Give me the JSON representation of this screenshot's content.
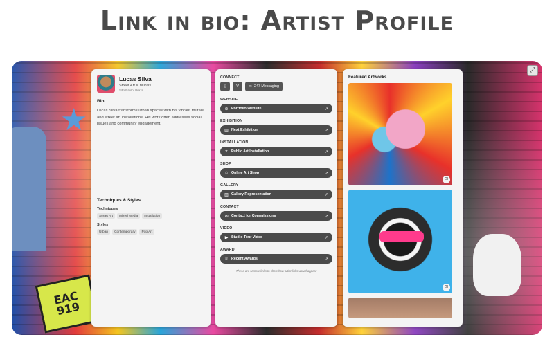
{
  "page": {
    "heading": "Link in bio: Artist Profile"
  },
  "profile": {
    "name": "Lucas Silva",
    "subtitle": "Street Art & Murals",
    "location": "São Paulo, Brazil",
    "bio_title": "Bio",
    "bio_text": "Lucas Silva transforms urban spaces with his vibrant murals and street art installations. His work often addresses social issues and community engagement."
  },
  "techniques": {
    "title": "Techniques & Styles",
    "techniques_label": "Techniques",
    "techniques": [
      "Street Art",
      "Mixed Media",
      "Installation"
    ],
    "styles_label": "Styles",
    "styles": [
      "Urban",
      "Contemporary",
      "Pop Art"
    ]
  },
  "links": {
    "connect_label": "CONNECT",
    "social": [
      {
        "icon": "instagram-icon"
      },
      {
        "icon": "vimeo-icon"
      },
      {
        "icon": "message-icon",
        "label": "247 Messaging"
      }
    ],
    "groups": [
      {
        "category": "WEBSITE",
        "label": "Portfolio Website",
        "icon": "globe-icon"
      },
      {
        "category": "EXHIBITION",
        "label": "Next Exhibition",
        "icon": "building-icon"
      },
      {
        "category": "INSTALLATION",
        "label": "Public Art Installation",
        "icon": "location-pin-icon"
      },
      {
        "category": "SHOP",
        "label": "Online Art Shop",
        "icon": "shop-icon"
      },
      {
        "category": "GALLERY",
        "label": "Gallery Representation",
        "icon": "building-icon"
      },
      {
        "category": "CONTACT",
        "label": "Contact for Commissions",
        "icon": "mail-icon"
      },
      {
        "category": "VIDEO",
        "label": "Studio Tour Video",
        "icon": "video-icon"
      },
      {
        "category": "AWARD",
        "label": "Recent Awards",
        "icon": "award-icon"
      }
    ],
    "footer_note": "These are sample links to show how artist links would appear"
  },
  "artworks": {
    "title": "Featured Artworks"
  }
}
